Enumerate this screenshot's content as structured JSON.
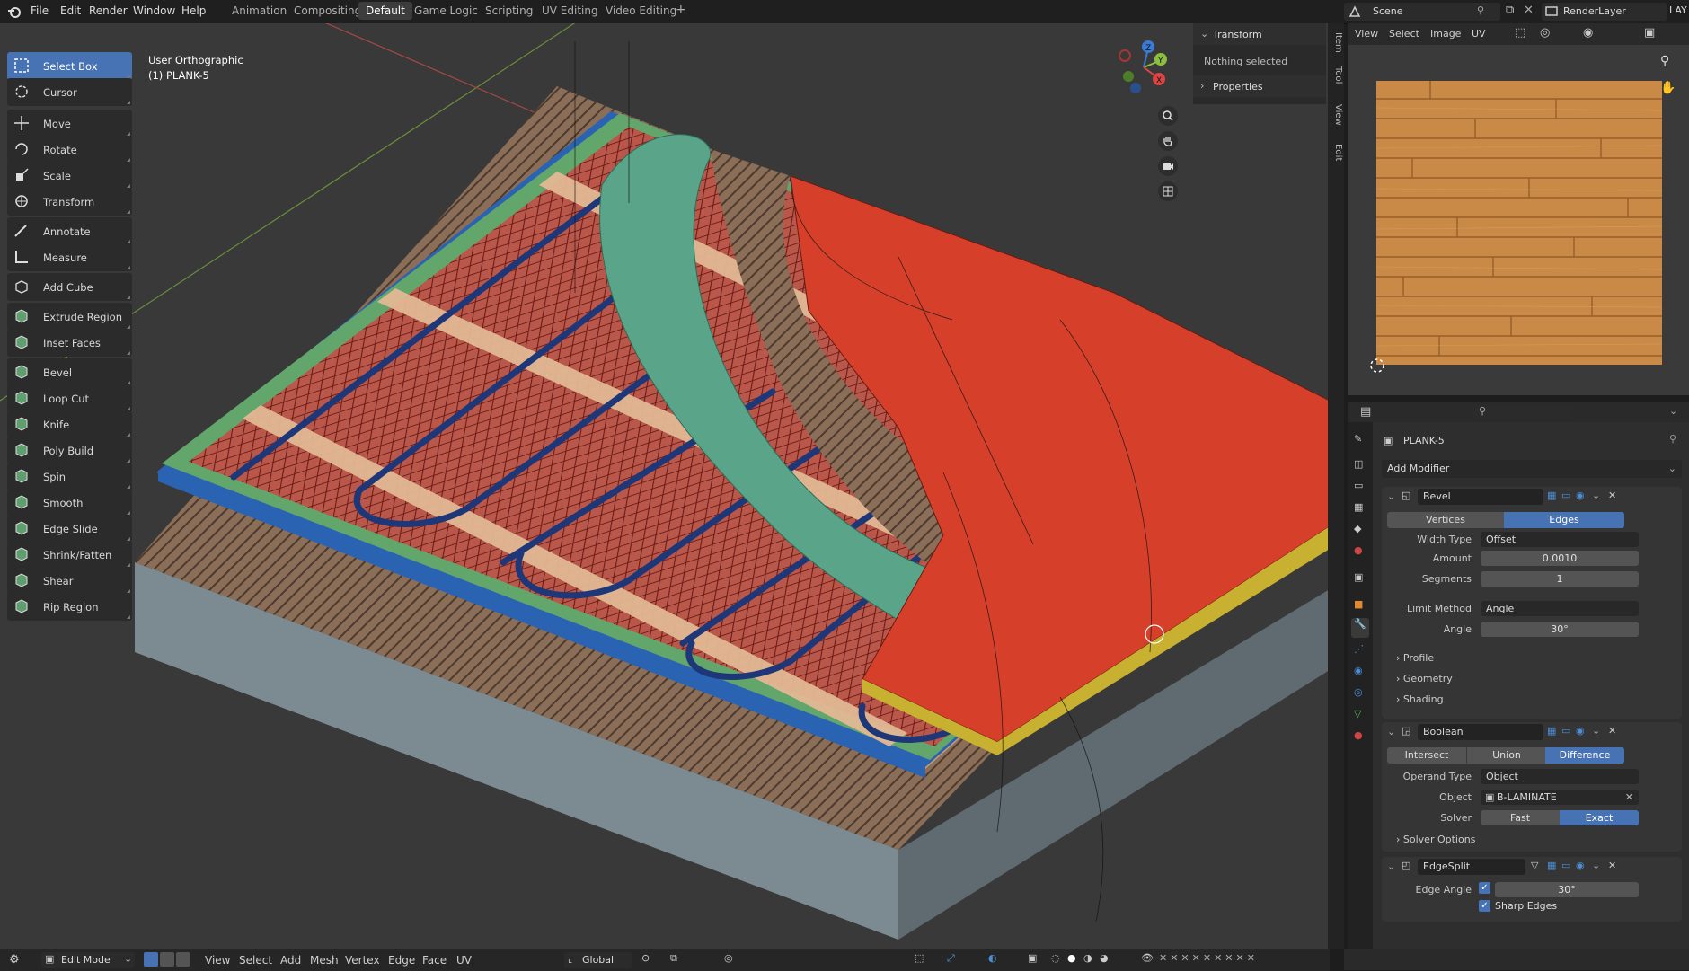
{
  "menu": {
    "items": [
      "File",
      "Edit",
      "Render",
      "Window",
      "Help"
    ],
    "workspaces": [
      "Animation",
      "Compositing",
      "Default",
      "Game Logic",
      "Scripting",
      "UV Editing",
      "Video Editing"
    ],
    "active_workspace": "Default",
    "add_tab": "+",
    "scene": "Scene",
    "render_layer": "RenderLayer",
    "layer_short": "LAY"
  },
  "viewport": {
    "view_name": "User Orthographic",
    "object_name": "(1) PLANK-5"
  },
  "tools": [
    {
      "label": "Select Box",
      "icon": "select-box-icon",
      "active": true
    },
    {
      "label": "Cursor",
      "icon": "cursor-icon"
    },
    {
      "label": "Move",
      "icon": "move-icon"
    },
    {
      "label": "Rotate",
      "icon": "rotate-icon"
    },
    {
      "label": "Scale",
      "icon": "scale-icon"
    },
    {
      "label": "Transform",
      "icon": "transform-icon"
    },
    {
      "label": "Annotate",
      "icon": "annotate-icon"
    },
    {
      "label": "Measure",
      "icon": "measure-icon"
    },
    {
      "label": "Add Cube",
      "icon": "add-cube-icon"
    },
    {
      "label": "Extrude Region",
      "icon": "extrude-icon"
    },
    {
      "label": "Inset Faces",
      "icon": "inset-icon"
    },
    {
      "label": "Bevel",
      "icon": "bevel-icon"
    },
    {
      "label": "Loop Cut",
      "icon": "loop-cut-icon"
    },
    {
      "label": "Knife",
      "icon": "knife-icon"
    },
    {
      "label": "Poly Build",
      "icon": "poly-build-icon"
    },
    {
      "label": "Spin",
      "icon": "spin-icon"
    },
    {
      "label": "Smooth",
      "icon": "smooth-icon"
    },
    {
      "label": "Edge Slide",
      "icon": "edge-slide-icon"
    },
    {
      "label": "Shrink/Fatten",
      "icon": "shrink-fatten-icon"
    },
    {
      "label": "Shear",
      "icon": "shear-icon"
    },
    {
      "label": "Rip Region",
      "icon": "rip-icon"
    }
  ],
  "npanel": {
    "transform": "Transform",
    "nothing_selected": "Nothing selected",
    "properties": "Properties",
    "tabs": [
      "Item",
      "Tool",
      "View",
      "Edit"
    ]
  },
  "gizmo": {
    "x": "X",
    "y": "Y",
    "z": "Z"
  },
  "uv_editor": {
    "menus": [
      "View",
      "Select",
      "Image",
      "UV"
    ]
  },
  "properties": {
    "object": "PLANK-5",
    "add_modifier": "Add Modifier",
    "bevel": {
      "name": "Bevel",
      "modes": [
        "Vertices",
        "Edges"
      ],
      "active_mode": "Edges",
      "width_type_label": "Width Type",
      "width_type": "Offset",
      "amount_label": "Amount",
      "amount": "0.0010",
      "segments_label": "Segments",
      "segments": "1",
      "limit_method_label": "Limit Method",
      "limit_method": "Angle",
      "angle_label": "Angle",
      "angle": "30°",
      "profile": "Profile",
      "geometry": "Geometry",
      "shading": "Shading"
    },
    "boolean": {
      "name": "Boolean",
      "modes": [
        "Intersect",
        "Union",
        "Difference"
      ],
      "active_mode": "Difference",
      "operand_type_label": "Operand Type",
      "operand_type": "Object",
      "object_label": "Object",
      "object": "B-LAMINATE",
      "solver_label": "Solver",
      "solver_fast": "Fast",
      "solver_exact": "Exact",
      "solver_options": "Solver Options"
    },
    "edgesplit": {
      "name": "EdgeSplit",
      "edge_angle_label": "Edge Angle",
      "edge_angle": "30°",
      "sharp_edges": "Sharp Edges"
    }
  },
  "bottom": {
    "mode": "Edit Mode",
    "menus": [
      "View",
      "Select",
      "Add",
      "Mesh",
      "Vertex",
      "Edge",
      "Face",
      "UV"
    ],
    "orientation": "Global"
  },
  "colors": {
    "accent": "#4772b3",
    "laminate_red": "#d6402b",
    "underlay_teal": "#5aa58a",
    "grid_red": "#b8574a",
    "pipe_blue": "#1f3f86",
    "wood": "#c98a48"
  }
}
